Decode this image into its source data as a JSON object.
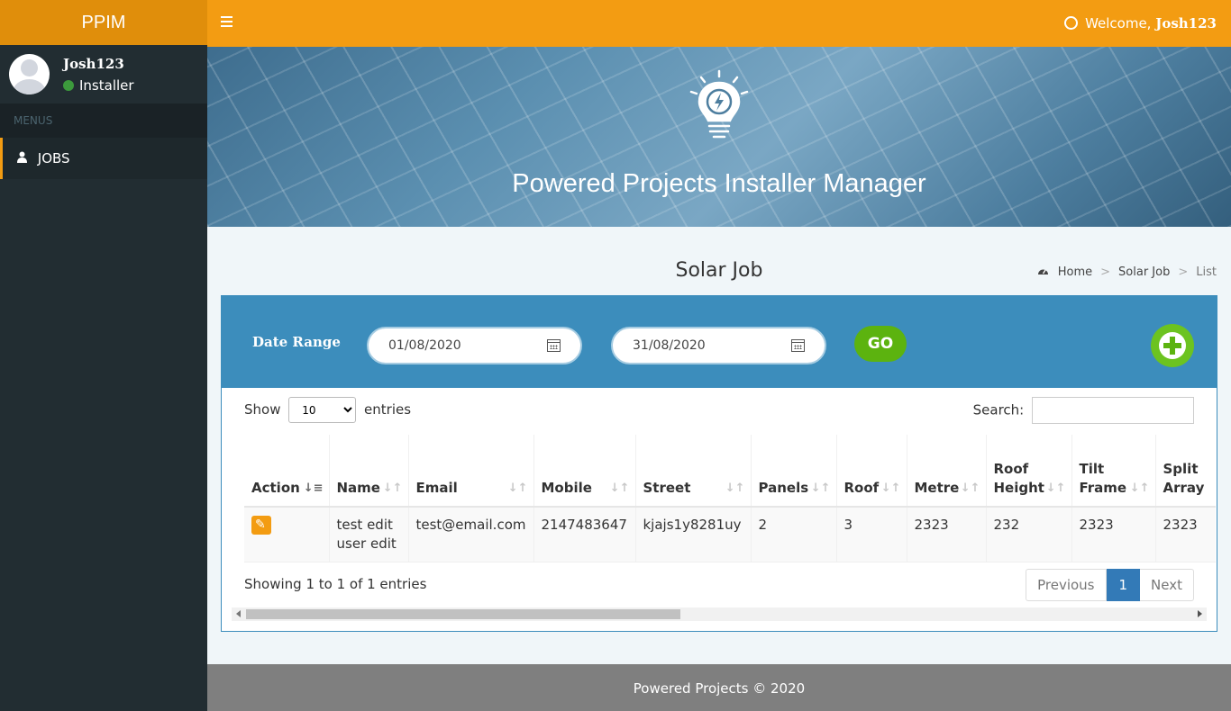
{
  "brand": "PPIM",
  "user": {
    "name": "Josh123",
    "role": "Installer"
  },
  "sidebar": {
    "menu_header": "MENUS",
    "items": [
      {
        "label": "JOBS",
        "icon": "user-icon"
      }
    ]
  },
  "topbar": {
    "welcome_prefix": "Welcome,",
    "welcome_user": "Josh123"
  },
  "hero": {
    "title": "Powered Projects Installer Manager",
    "icon": "lightbulb-icon"
  },
  "page": {
    "title": "Solar Job"
  },
  "breadcrumb": {
    "home": "Home",
    "section": "Solar Job",
    "current": "List"
  },
  "filter": {
    "date_range_label": "Date Range",
    "date_from": "01/08/2020",
    "date_to": "31/08/2020",
    "go_label": "GO"
  },
  "table": {
    "show_label": "Show",
    "page_size": "10",
    "entries_label": "entries",
    "search_label": "Search:",
    "search_value": "",
    "columns": [
      "Action",
      "Name",
      "Email",
      "Mobile",
      "Street",
      "Panels",
      "Roof",
      "Metre",
      "Roof Height",
      "Tilt Frame",
      "Split Array"
    ],
    "rows": [
      {
        "name": "test edit user edit",
        "email": "test@email.com",
        "mobile": "2147483647",
        "street": "kjajs1y8281uy",
        "panels": "2",
        "roof": "3",
        "metre": "2323",
        "roof_height": "232",
        "tilt_frame": "2323",
        "split_array": "2323"
      }
    ],
    "info": "Showing 1 to 1 of 1 entries",
    "pagination": {
      "previous": "Previous",
      "current_page": "1",
      "next": "Next"
    }
  },
  "footer": {
    "text": "Powered Projects © 2020"
  },
  "colors": {
    "topbar": "#f39c12",
    "logo": "#e08e0b",
    "sidebar": "#222d32",
    "box": "#3c8dbc",
    "go": "#5cb30f"
  }
}
